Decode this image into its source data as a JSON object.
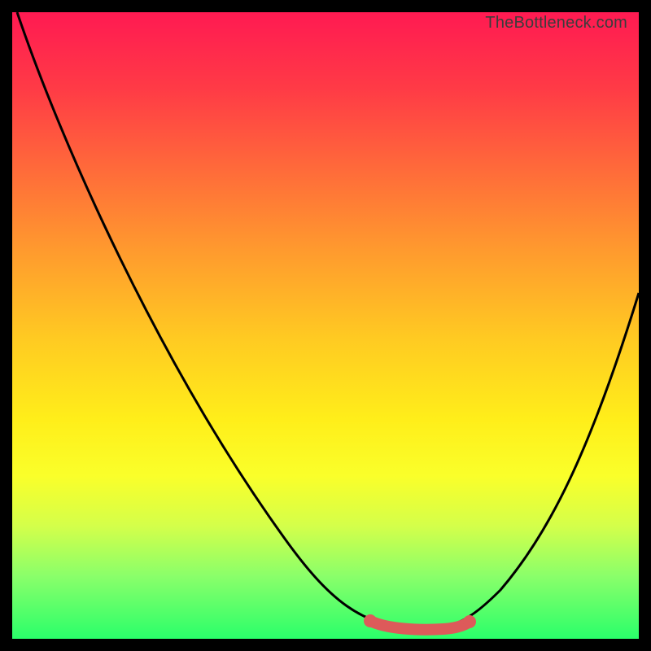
{
  "attribution": "TheBottleneck.com",
  "chart_data": {
    "type": "line",
    "title": "",
    "xlabel": "",
    "ylabel": "",
    "xlim": [
      0,
      100
    ],
    "ylim": [
      0,
      100
    ],
    "series": [
      {
        "name": "bottleneck-curve",
        "x": [
          0,
          5,
          10,
          15,
          20,
          25,
          30,
          35,
          40,
          45,
          50,
          55,
          58,
          62,
          66,
          70,
          72,
          76,
          80,
          85,
          90,
          95,
          100
        ],
        "y": [
          100,
          94,
          88,
          80,
          72,
          63,
          54,
          45,
          36,
          27,
          18,
          10,
          5,
          2,
          1,
          1,
          2,
          5,
          11,
          20,
          32,
          46,
          56
        ]
      }
    ],
    "highlight": {
      "name": "optimal-range",
      "x": [
        58,
        62,
        66,
        70,
        72
      ],
      "y": [
        5,
        2,
        1,
        1,
        2
      ]
    },
    "gradient_stops": [
      {
        "pos": 0,
        "color": "#ff1a52"
      },
      {
        "pos": 25,
        "color": "#ff6a3a"
      },
      {
        "pos": 52,
        "color": "#ffca22"
      },
      {
        "pos": 74,
        "color": "#faff2a"
      },
      {
        "pos": 100,
        "color": "#2aff6a"
      }
    ]
  }
}
